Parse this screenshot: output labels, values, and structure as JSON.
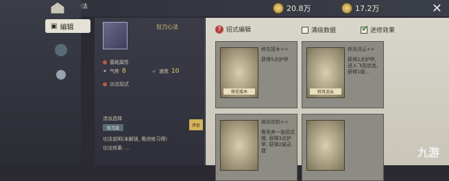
{
  "header": {
    "title": "功法"
  },
  "sidebar": {
    "tab_label": "编辑"
  },
  "currencies": [
    {
      "value": "20.8万"
    },
    {
      "value": "17.2万"
    }
  ],
  "left": {
    "skill_name": "狂刀心法",
    "rows": [
      {
        "label": "基础属性",
        "value": ""
      },
      {
        "label": "气势",
        "value": "8"
      },
      {
        "label": "速度",
        "value": "10"
      },
      {
        "label": "功法招式",
        "value": ""
      },
      {
        "label": "流派选择",
        "value": ""
      },
      {
        "label": "功法说明(未解锁, 需进修习得)",
        "value": ""
      },
      {
        "label": "功法效果: ...",
        "value": ""
      }
    ],
    "badge": "狂刀流",
    "skill_tag": "评价"
  },
  "right": {
    "edit_title": "招式编辑",
    "check_full": "满级数据",
    "check_adv": "进修效果",
    "cards": [
      {
        "title": "移花接木++",
        "desc": "获得5点护甲",
        "label": "移花接木"
      },
      {
        "title": "转风流云++",
        "desc": "获得2点护甲, 进入飞花状态, 获得1层...",
        "label": "转风流云"
      },
      {
        "title": "",
        "desc": "",
        "label": ""
      },
      {
        "title": "擒龙控鹤++",
        "desc": "需丢弃一张招式牌, 获得3点护甲, 获得2层迅捷",
        "label": ""
      }
    ]
  },
  "watermark": "九游"
}
